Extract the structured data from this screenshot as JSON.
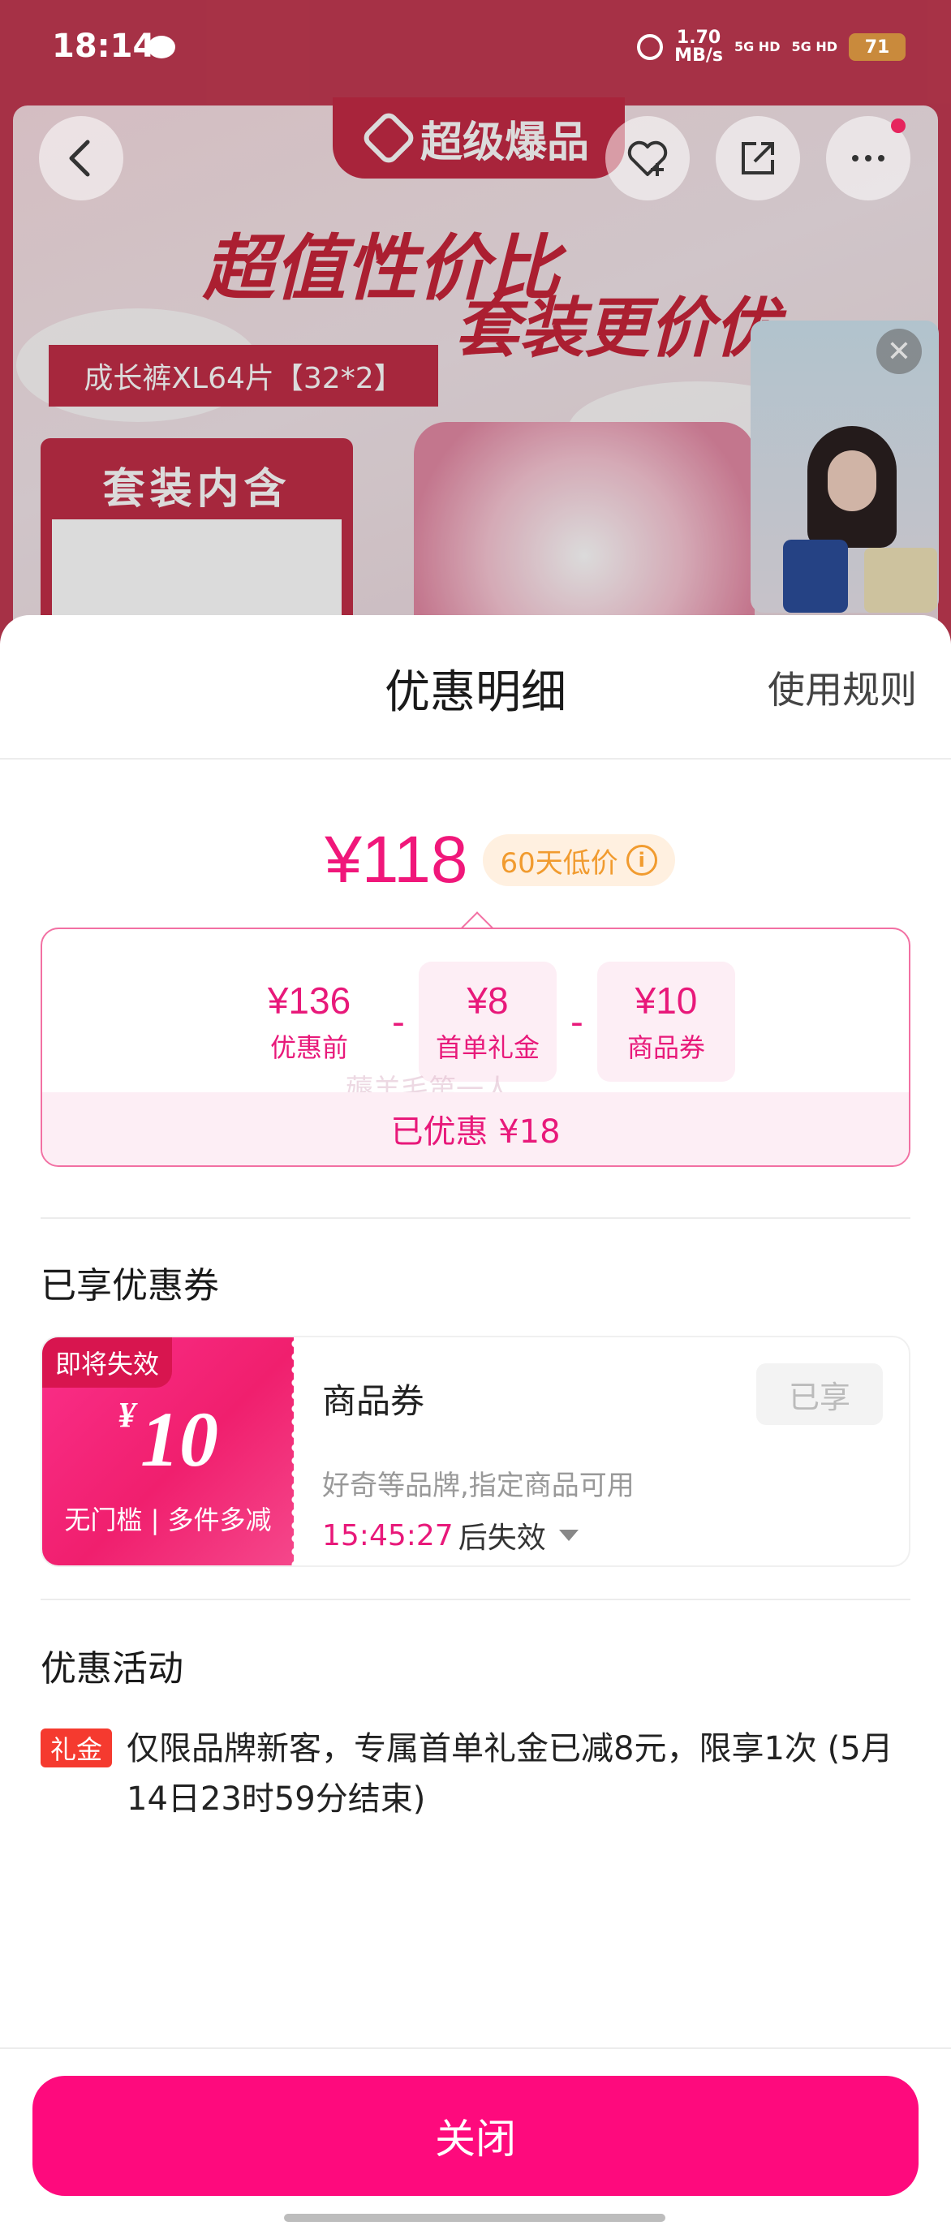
{
  "status_bar": {
    "time": "18:14",
    "speed_value": "1.70",
    "speed_unit": "MB/s",
    "signal_1": "5G HD",
    "signal_2": "5G HD",
    "battery": "71"
  },
  "background": {
    "tag": "超级爆品",
    "headline_1": "超值性价比",
    "headline_2": "套装更价优",
    "size_label": "成长裤XL64片【32*2】",
    "set_label": "套装内含"
  },
  "sheet": {
    "title": "优惠明细",
    "rules_link": "使用规则",
    "final_price": "¥118",
    "low_price_badge": "60天低价",
    "breakdown": [
      {
        "value": "¥136",
        "label": "优惠前",
        "highlight": false
      },
      {
        "value": "¥8",
        "label": "首单礼金",
        "highlight": true
      },
      {
        "value": "¥10",
        "label": "商品券",
        "highlight": true
      }
    ],
    "watermark": "薅羊毛第一人",
    "saved_text": "已优惠 ¥18",
    "coupons_section_title": "已享优惠券",
    "coupon": {
      "expire_tag": "即将失效",
      "currency": "¥",
      "amount": "10",
      "condition": "无门槛 | 多件多减",
      "name": "商品券",
      "description": "好奇等品牌,指定商品可用",
      "countdown": "15:45:27",
      "countdown_suffix": "后失效",
      "status_button": "已享"
    },
    "activities_section_title": "优惠活动",
    "activity": {
      "tag": "礼金",
      "text": "仅限品牌新客，专属首单礼金已减8元，限享1次 (5月14日23时59分结束)"
    },
    "close_button": "关闭"
  },
  "colors": {
    "accent": "#fe0a7d",
    "price": "#f0177a",
    "badge_orange": "#f19b2f",
    "gift_tag": "#f53a2f"
  }
}
